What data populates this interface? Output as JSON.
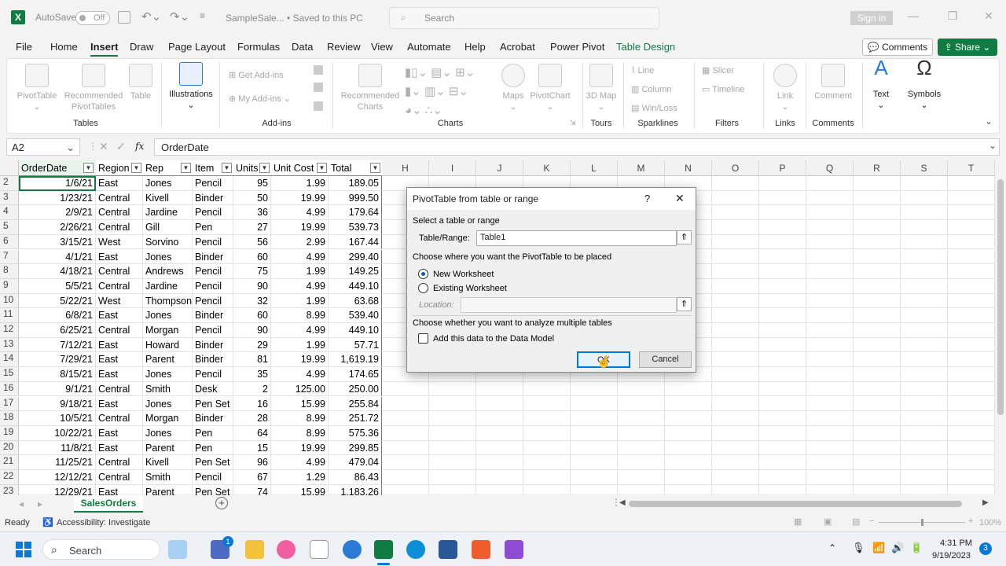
{
  "titlebar": {
    "autosave_label": "AutoSave",
    "autosave_state": "Off",
    "filename": "SampleSale... • Saved to this PC",
    "search_placeholder": "Search",
    "signin": "Sign in"
  },
  "menu": {
    "tabs": [
      "File",
      "Home",
      "Insert",
      "Draw",
      "Page Layout",
      "Formulas",
      "Data",
      "Review",
      "View",
      "Automate",
      "Help",
      "Acrobat",
      "Power Pivot",
      "Table Design"
    ],
    "active": "Insert",
    "comments": "Comments",
    "share": "Share"
  },
  "ribbon": {
    "tables": {
      "pivottable": "PivotTable",
      "recommended": "Recommended PivotTables",
      "table": "Table",
      "label": "Tables"
    },
    "illustrations": "Illustrations",
    "addins": {
      "get": "Get Add-ins",
      "my": "My Add-ins",
      "label": "Add-ins"
    },
    "charts": {
      "recommended": "Recommended Charts",
      "maps": "Maps",
      "pivotchart": "PivotChart",
      "label": "Charts"
    },
    "tours": {
      "map3d": "3D Map",
      "label": "Tours"
    },
    "sparklines": {
      "line": "Line",
      "column": "Column",
      "winloss": "Win/Loss",
      "label": "Sparklines"
    },
    "filters": {
      "slicer": "Slicer",
      "timeline": "Timeline",
      "label": "Filters"
    },
    "links": {
      "link": "Link",
      "label": "Links"
    },
    "comments": {
      "comment": "Comment",
      "label": "Comments"
    },
    "text": "Text",
    "symbols": "Symbols"
  },
  "formula": {
    "namebox": "A2",
    "fx": "fx",
    "content": "OrderDate"
  },
  "sheet": {
    "col_letters": [
      "H",
      "I",
      "J",
      "K",
      "L",
      "M",
      "N",
      "O",
      "P",
      "Q",
      "R",
      "S",
      "T"
    ],
    "headers": [
      "OrderDate",
      "Region",
      "Rep",
      "Item",
      "Units",
      "Unit Cost",
      "Total"
    ],
    "rows": [
      {
        "n": "2",
        "c": [
          "1/6/21",
          "East",
          "Jones",
          "Pencil",
          "95",
          "1.99",
          "189.05"
        ]
      },
      {
        "n": "3",
        "c": [
          "1/23/21",
          "Central",
          "Kivell",
          "Binder",
          "50",
          "19.99",
          "999.50"
        ]
      },
      {
        "n": "4",
        "c": [
          "2/9/21",
          "Central",
          "Jardine",
          "Pencil",
          "36",
          "4.99",
          "179.64"
        ]
      },
      {
        "n": "5",
        "c": [
          "2/26/21",
          "Central",
          "Gill",
          "Pen",
          "27",
          "19.99",
          "539.73"
        ]
      },
      {
        "n": "6",
        "c": [
          "3/15/21",
          "West",
          "Sorvino",
          "Pencil",
          "56",
          "2.99",
          "167.44"
        ]
      },
      {
        "n": "7",
        "c": [
          "4/1/21",
          "East",
          "Jones",
          "Binder",
          "60",
          "4.99",
          "299.40"
        ]
      },
      {
        "n": "8",
        "c": [
          "4/18/21",
          "Central",
          "Andrews",
          "Pencil",
          "75",
          "1.99",
          "149.25"
        ]
      },
      {
        "n": "9",
        "c": [
          "5/5/21",
          "Central",
          "Jardine",
          "Pencil",
          "90",
          "4.99",
          "449.10"
        ]
      },
      {
        "n": "10",
        "c": [
          "5/22/21",
          "West",
          "Thompson",
          "Pencil",
          "32",
          "1.99",
          "63.68"
        ]
      },
      {
        "n": "11",
        "c": [
          "6/8/21",
          "East",
          "Jones",
          "Binder",
          "60",
          "8.99",
          "539.40"
        ]
      },
      {
        "n": "12",
        "c": [
          "6/25/21",
          "Central",
          "Morgan",
          "Pencil",
          "90",
          "4.99",
          "449.10"
        ]
      },
      {
        "n": "13",
        "c": [
          "7/12/21",
          "East",
          "Howard",
          "Binder",
          "29",
          "1.99",
          "57.71"
        ]
      },
      {
        "n": "14",
        "c": [
          "7/29/21",
          "East",
          "Parent",
          "Binder",
          "81",
          "19.99",
          "1,619.19"
        ]
      },
      {
        "n": "15",
        "c": [
          "8/15/21",
          "East",
          "Jones",
          "Pencil",
          "35",
          "4.99",
          "174.65"
        ]
      },
      {
        "n": "16",
        "c": [
          "9/1/21",
          "Central",
          "Smith",
          "Desk",
          "2",
          "125.00",
          "250.00"
        ]
      },
      {
        "n": "17",
        "c": [
          "9/18/21",
          "East",
          "Jones",
          "Pen Set",
          "16",
          "15.99",
          "255.84"
        ]
      },
      {
        "n": "18",
        "c": [
          "10/5/21",
          "Central",
          "Morgan",
          "Binder",
          "28",
          "8.99",
          "251.72"
        ]
      },
      {
        "n": "19",
        "c": [
          "10/22/21",
          "East",
          "Jones",
          "Pen",
          "64",
          "8.99",
          "575.36"
        ]
      },
      {
        "n": "20",
        "c": [
          "11/8/21",
          "East",
          "Parent",
          "Pen",
          "15",
          "19.99",
          "299.85"
        ]
      },
      {
        "n": "21",
        "c": [
          "11/25/21",
          "Central",
          "Kivell",
          "Pen Set",
          "96",
          "4.99",
          "479.04"
        ]
      },
      {
        "n": "22",
        "c": [
          "12/12/21",
          "Central",
          "Smith",
          "Pencil",
          "67",
          "1.29",
          "86.43"
        ]
      },
      {
        "n": "23",
        "c": [
          "12/29/21",
          "East",
          "Parent",
          "Pen Set",
          "74",
          "15.99",
          "1,183.26"
        ]
      }
    ],
    "tab": "SalesOrders"
  },
  "status": {
    "ready": "Ready",
    "accessibility": "Accessibility: Investigate",
    "zoom": "100%"
  },
  "dialog": {
    "title": "PivotTable from table or range",
    "help": "?",
    "close": "✕",
    "select_label": "Select a table or range",
    "range_label": "Table/Range:",
    "range_value": "Table1",
    "place_label": "Choose where you want the PivotTable to be placed",
    "new_ws": "New Worksheet",
    "existing_ws": "Existing Worksheet",
    "location_label": "Location:",
    "multi_label": "Choose whether you want to analyze multiple tables",
    "datamodel": "Add this data to the Data Model",
    "ok": "OK",
    "cancel": "Cancel"
  },
  "taskbar": {
    "search": "Search",
    "time": "4:31 PM",
    "date": "9/19/2023",
    "badge": "3",
    "store_badge": "1"
  }
}
